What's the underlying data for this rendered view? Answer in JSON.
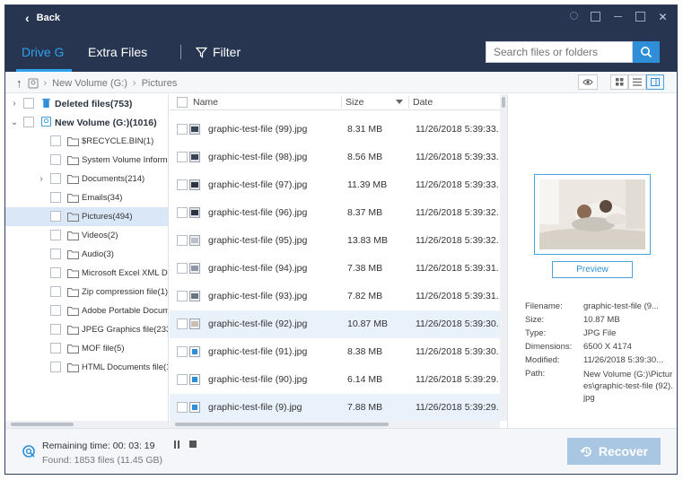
{
  "titlebar": {
    "back_label": "Back"
  },
  "tabs": {
    "drive": "Drive G",
    "extra": "Extra Files",
    "filter": "Filter"
  },
  "search": {
    "placeholder": "Search files or folders"
  },
  "breadcrumb": {
    "volume": "New Volume (G:)",
    "folder": "Pictures"
  },
  "tree": {
    "roots": [
      {
        "label": "Deleted files(753)",
        "expanded": false
      },
      {
        "label": "New Volume (G:)(1016)",
        "expanded": true
      }
    ],
    "folders": [
      {
        "label": "$RECYCLE.BIN(1)"
      },
      {
        "label": "System Volume Informa"
      },
      {
        "label": "Documents(214)"
      },
      {
        "label": "Emails(34)"
      },
      {
        "label": "Pictures(494)"
      },
      {
        "label": "Videos(2)"
      },
      {
        "label": "Audio(3)"
      },
      {
        "label": "Microsoft Excel XML Do"
      },
      {
        "label": "Zip compression file(1)"
      },
      {
        "label": "Adobe Portable Docume"
      },
      {
        "label": "JPEG Graphics file(233)"
      },
      {
        "label": "MOF file(5)"
      },
      {
        "label": "HTML Documents file(1"
      }
    ]
  },
  "columns": {
    "name": "Name",
    "size": "Size",
    "date": "Date"
  },
  "files": [
    {
      "name": "graphic-test-file (99).jpg",
      "size": "8.31 MB",
      "date": "11/26/2018 5:39:33."
    },
    {
      "name": "graphic-test-file (98).jpg",
      "size": "8.56 MB",
      "date": "11/26/2018 5:39:33."
    },
    {
      "name": "graphic-test-file (97).jpg",
      "size": "11.39 MB",
      "date": "11/26/2018 5:39:33."
    },
    {
      "name": "graphic-test-file (96).jpg",
      "size": "8.37 MB",
      "date": "11/26/2018 5:39:32."
    },
    {
      "name": "graphic-test-file (95).jpg",
      "size": "13.83 MB",
      "date": "11/26/2018 5:39:32."
    },
    {
      "name": "graphic-test-file (94).jpg",
      "size": "7.38 MB",
      "date": "11/26/2018 5:39:31."
    },
    {
      "name": "graphic-test-file (93).jpg",
      "size": "7.82 MB",
      "date": "11/26/2018 5:39:31."
    },
    {
      "name": "graphic-test-file (92).jpg",
      "size": "10.87 MB",
      "date": "11/26/2018 5:39:30."
    },
    {
      "name": "graphic-test-file (91).jpg",
      "size": "8.38 MB",
      "date": "11/26/2018 5:39:30."
    },
    {
      "name": "graphic-test-file (90).jpg",
      "size": "6.14 MB",
      "date": "11/26/2018 5:39:29."
    },
    {
      "name": "graphic-test-file (9).jpg",
      "size": "7.88 MB",
      "date": "11/26/2018 5:39:29."
    }
  ],
  "preview": {
    "button": "Preview",
    "labels": {
      "filename": "Filename:",
      "size": "Size:",
      "type": "Type:",
      "dimensions": "Dimensions:",
      "modified": "Modified:",
      "path": "Path:"
    },
    "values": {
      "filename": "graphic-test-file (9...",
      "size": "10.87 MB",
      "type": "JPG File",
      "dimensions": "6500 X 4174",
      "modified": "11/26/2018 5:39:30...",
      "path": "New Volume (G:)\\Pictures\\graphic-test-file (92).jpg"
    }
  },
  "footer": {
    "remaining": "Remaining time: 00: 03: 19",
    "found": "Found: 1853 files (11.45 GB)",
    "recover": "Recover"
  },
  "colors": {
    "titlebar": "#273550",
    "accent": "#2fa1ea",
    "recover_disabled": "#a9c6e2"
  },
  "icons": [
    "chevron-left-icon",
    "filter-icon",
    "search-icon",
    "eye-icon",
    "grid-view-icon",
    "list-view-icon",
    "detail-view-icon",
    "folder-icon",
    "drive-icon",
    "trash-icon",
    "image-file-icon",
    "scan-icon",
    "pause-icon",
    "stop-icon",
    "recover-icon"
  ]
}
